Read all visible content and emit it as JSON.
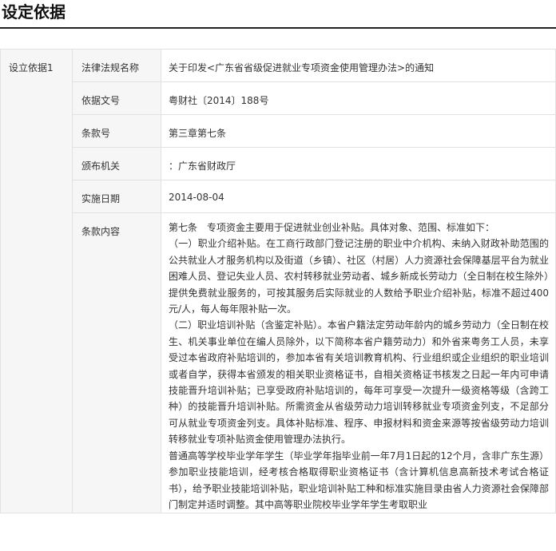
{
  "header": {
    "title": "设定依据"
  },
  "basis": {
    "label": "设立依据1",
    "rows": [
      {
        "label": "法律法规名称",
        "value": "关于印发<广东省省级促进就业专项资金使用管理办法>的通知"
      },
      {
        "label": "依据文号",
        "value": "粤财社〔2014〕188号"
      },
      {
        "label": "条款号",
        "value": "第三章第七条"
      },
      {
        "label": "颁布机关",
        "value": "：广东省财政厅"
      },
      {
        "label": "实施日期",
        "value": "2014-08-04"
      }
    ],
    "content_label": "条款内容",
    "content_paragraphs": [
      "第七条　专项资金主要用于促进就业创业补贴。具体对象、范围、标准如下：",
      "（一）职业介绍补贴。在工商行政部门登记注册的职业中介机构、未纳入财政补助范围的公共就业人才服务机构以及街道（乡镇）、社区（村居）人力资源社会保障基层平台为就业困难人员、登记失业人员、农村转移就业劳动者、城乡新成长劳动力（全日制在校生除外）提供免费就业服务的，可按其服务后实际就业的人数给予职业介绍补贴，标准不超过400元/人，每人每年限补贴一次。",
      "（二）职业培训补贴（含鉴定补贴）。本省户籍法定劳动年龄内的城乡劳动力（全日制在校生、机关事业单位在编人员除外，以下简称本省户籍劳动力）和外省来粤务工人员，未享受过本省政府补贴培训的，参加本省有关培训教育机构、行业组织或企业组织的职业培训或者自学，获得本省颁发的相关职业资格证书，自相关资格证书核发之日起一年内可申请技能晋升培训补贴；已享受政府补贴培训的，每年可享受一次提升一级资格等级（含跨工种）的技能晋升培训补贴。所需资金从省级劳动力培训转移就业专项资金列支，不足部分可从就业专项资金列支。具体补贴标准、程序、申报材料和资金来源等按省级劳动力培训转移就业专项补贴资金使用管理办法执行。",
      "普通高等学校毕业学年学生（毕业学年指毕业前一年7月1日起的12个月，含非广东生源）参加职业技能培训，经考核合格取得职业资格证书（含计算机信息高新技术考试合格证书），给予职业技能培训补贴，职业培训补贴工种和标准实施目录由省人力资源社会保障部门制定并适时调整。其中高等职业院校毕业学年学生考取职业"
    ]
  }
}
